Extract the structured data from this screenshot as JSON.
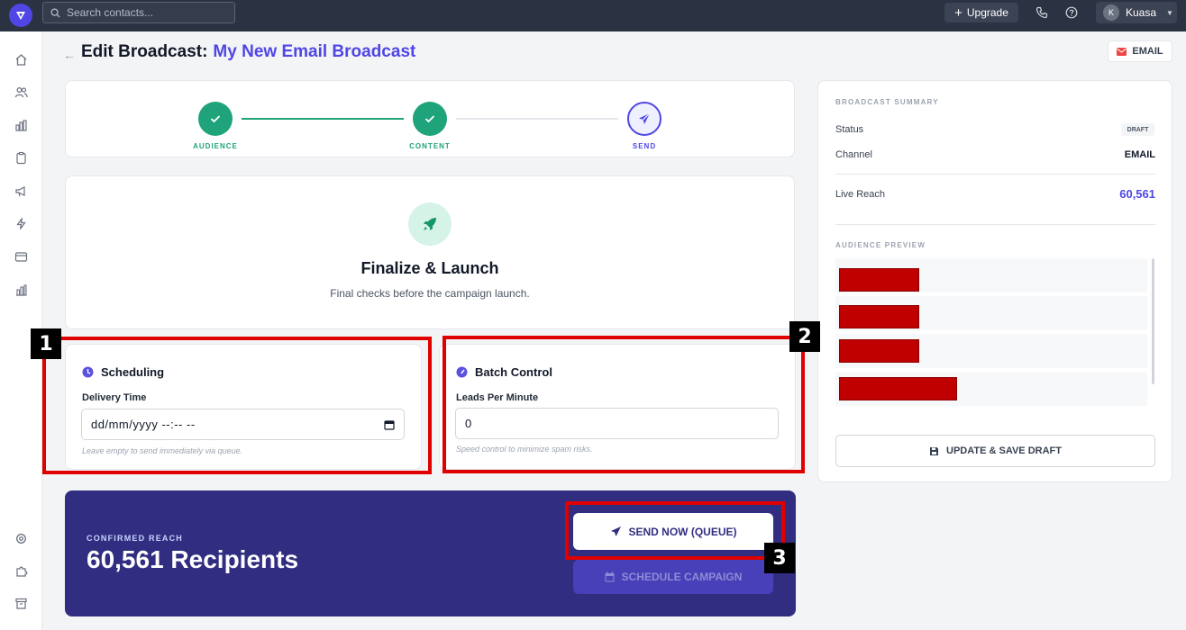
{
  "topbar": {
    "search_placeholder": "Search contacts...",
    "upgrade_label": "Upgrade",
    "user_initial": "K",
    "user_name": "Kuasa"
  },
  "header": {
    "title_prefix": "Edit Broadcast:",
    "broadcast_name": "My New Email Broadcast",
    "channel_chip": "EMAIL"
  },
  "stepper": {
    "steps": [
      {
        "label": "AUDIENCE",
        "state": "done"
      },
      {
        "label": "CONTENT",
        "state": "done"
      },
      {
        "label": "SEND",
        "state": "current"
      }
    ]
  },
  "finalize": {
    "title": "Finalize & Launch",
    "subtitle": "Final checks before the campaign launch."
  },
  "scheduling": {
    "heading": "Scheduling",
    "field_label": "Delivery Time",
    "field_value": "dd/mm/yyyy --:-- --",
    "hint": "Leave empty to send immediately via queue."
  },
  "batch": {
    "heading": "Batch Control",
    "field_label": "Leads Per Minute",
    "field_value": "0",
    "hint": "Speed control to minimize spam risks."
  },
  "summary": {
    "title": "BROADCAST SUMMARY",
    "status_label": "Status",
    "status_value": "DRAFT",
    "channel_label": "Channel",
    "channel_value": "EMAIL",
    "reach_label": "Live Reach",
    "reach_value": "60,561",
    "preview_title": "AUDIENCE PREVIEW",
    "save_label": "UPDATE & SAVE DRAFT"
  },
  "reach_banner": {
    "label": "CONFIRMED REACH",
    "value": "60,561 Recipients",
    "send_label": "SEND NOW (QUEUE)",
    "schedule_label": "SCHEDULE CAMPAIGN"
  },
  "annotations": [
    "1",
    "2",
    "3"
  ],
  "colors": {
    "accent": "#4f46e5",
    "success": "#1fa37a",
    "banner": "#312e81",
    "topbar": "#2b3242",
    "highlight": "#e00000",
    "redaction": "#c00000"
  }
}
